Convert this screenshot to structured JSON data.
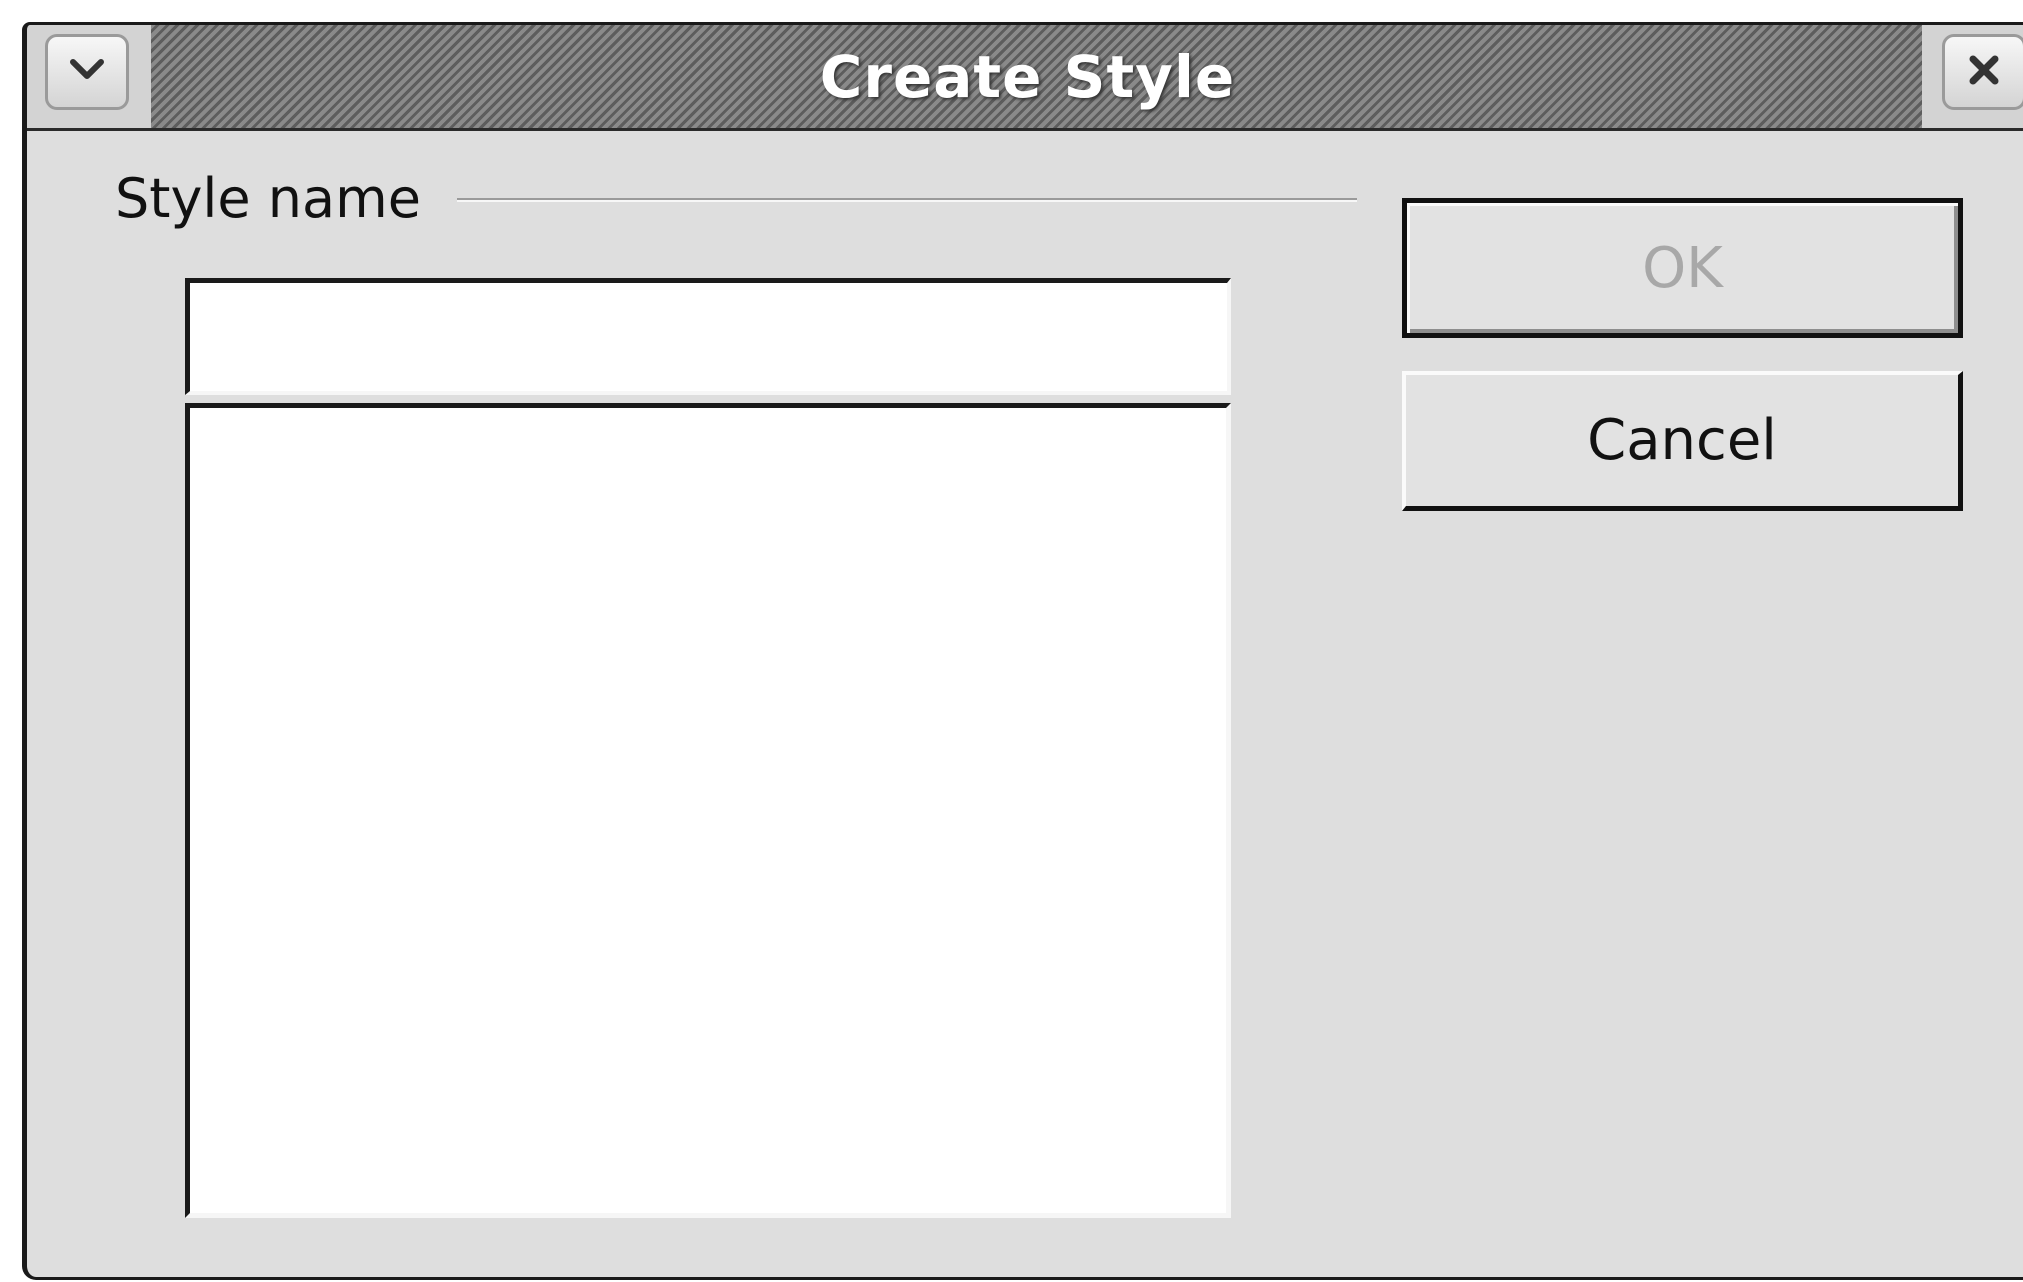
{
  "window": {
    "title": "Create Style"
  },
  "titlebar": {
    "menu_icon": "chevron-down-icon",
    "close_icon": "close-icon"
  },
  "form": {
    "group_label": "Style name",
    "name_value": "",
    "styles": []
  },
  "buttons": {
    "ok_label": "OK",
    "ok_enabled": false,
    "cancel_label": "Cancel"
  }
}
